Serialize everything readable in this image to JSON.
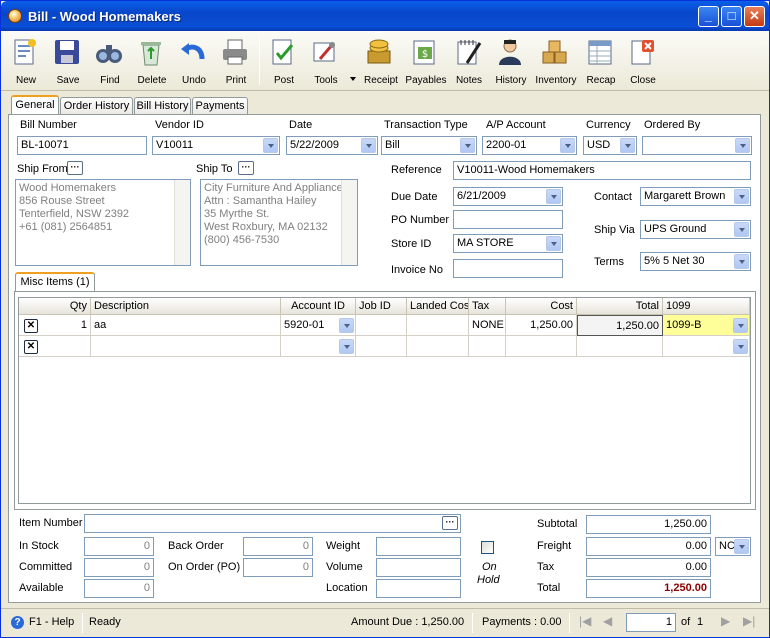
{
  "window": {
    "title": "Bill - Wood Homemakers"
  },
  "toolbar": [
    {
      "label": "New",
      "icon": "new-document-icon"
    },
    {
      "label": "Save",
      "icon": "floppy-disk-icon"
    },
    {
      "label": "Find",
      "icon": "binoculars-icon"
    },
    {
      "label": "Delete",
      "icon": "recycle-bin-icon"
    },
    {
      "label": "Undo",
      "icon": "undo-arrow-icon"
    },
    {
      "label": "Print",
      "icon": "printer-icon"
    },
    {
      "label": "Post",
      "icon": "post-checklist-icon"
    },
    {
      "label": "Tools",
      "icon": "tools-icon"
    },
    {
      "label": "Receipt",
      "icon": "receipt-coins-icon"
    },
    {
      "label": "Payables",
      "icon": "payables-icon"
    },
    {
      "label": "Notes",
      "icon": "notepad-icon"
    },
    {
      "label": "History",
      "icon": "history-person-icon"
    },
    {
      "label": "Inventory",
      "icon": "boxes-icon"
    },
    {
      "label": "Recap",
      "icon": "recap-sheet-icon"
    },
    {
      "label": "Close",
      "icon": "close-door-icon"
    }
  ],
  "tabs": [
    "General",
    "Order History",
    "Bill History",
    "Payments"
  ],
  "header": {
    "bill_number_label": "Bill Number",
    "bill_number": "BL-10071",
    "vendor_id_label": "Vendor ID",
    "vendor_id": "V10011",
    "date_label": "Date",
    "date": "5/22/2009",
    "transaction_type_label": "Transaction Type",
    "transaction_type": "Bill",
    "ap_account_label": "A/P Account",
    "ap_account": "2200-01",
    "currency_label": "Currency",
    "currency": "USD",
    "ordered_by_label": "Ordered By",
    "ordered_by": ""
  },
  "ship_from": {
    "label": "Ship From",
    "lines": [
      "Wood Homemakers",
      "856 Rouse Street",
      "Tenterfield, NSW 2392",
      "+61 (081) 2564851"
    ]
  },
  "ship_to": {
    "label": "Ship To",
    "lines": [
      "City Furniture And Appliance",
      "Attn : Samantha Hailey",
      "35 Myrthe St.",
      "West Roxbury, MA 02132",
      "(800) 456-7530"
    ]
  },
  "details": {
    "reference_label": "Reference",
    "reference": "V10011-Wood Homemakers",
    "due_date_label": "Due Date",
    "due_date": "6/21/2009",
    "po_number_label": "PO Number",
    "po_number": "",
    "store_id_label": "Store ID",
    "store_id": "MA STORE",
    "invoice_no_label": "Invoice No",
    "invoice_no": "",
    "contact_label": "Contact",
    "contact": "Margarett Brown",
    "ship_via_label": "Ship Via",
    "ship_via": "UPS Ground",
    "terms_label": "Terms",
    "terms": "5% 5 Net 30"
  },
  "misc_tab": "Misc Items (1)",
  "grid": {
    "columns": [
      "Qty",
      "Description",
      "Account ID",
      "Job ID",
      "Landed Cos",
      "Tax",
      "Cost",
      "Total",
      "1099"
    ],
    "rows": [
      {
        "qty": "1",
        "description": "aa",
        "account_id": "5920-01",
        "job_id": "",
        "landed": "",
        "tax": "NONE",
        "cost": "1,250.00",
        "total": "1,250.00",
        "f1099": "1099-B"
      },
      {
        "qty": "",
        "description": "",
        "account_id": "",
        "job_id": "",
        "landed": "",
        "tax": "",
        "cost": "",
        "total": "",
        "f1099": ""
      }
    ]
  },
  "footer": {
    "item_number_label": "Item Number",
    "item_number": "",
    "in_stock_label": "In Stock",
    "in_stock": "0",
    "committed_label": "Committed",
    "committed": "0",
    "available_label": "Available",
    "available": "0",
    "back_order_label": "Back Order",
    "back_order": "0",
    "on_order_label": "On Order (PO)",
    "on_order": "0",
    "weight_label": "Weight",
    "weight": "",
    "volume_label": "Volume",
    "volume": "",
    "location_label": "Location",
    "location": "",
    "on_hold_label_1": "On",
    "on_hold_label_2": "Hold",
    "subtotal_label": "Subtotal",
    "subtotal": "1,250.00",
    "freight_label": "Freight",
    "freight": "0.00",
    "freight_code": "NC",
    "tax_label": "Tax",
    "tax": "0.00",
    "total_label": "Total",
    "total": "1,250.00"
  },
  "statusbar": {
    "help": "F1 - Help",
    "state": "Ready",
    "amount_due": "Amount Due : 1,250.00",
    "payments": "Payments : 0.00",
    "page": "1",
    "of_label": "of",
    "page_count": "1"
  },
  "colors": {
    "title_bar": "#0a4fd6",
    "highlight_cell": "#ffff99",
    "total_text": "#8b0000"
  }
}
